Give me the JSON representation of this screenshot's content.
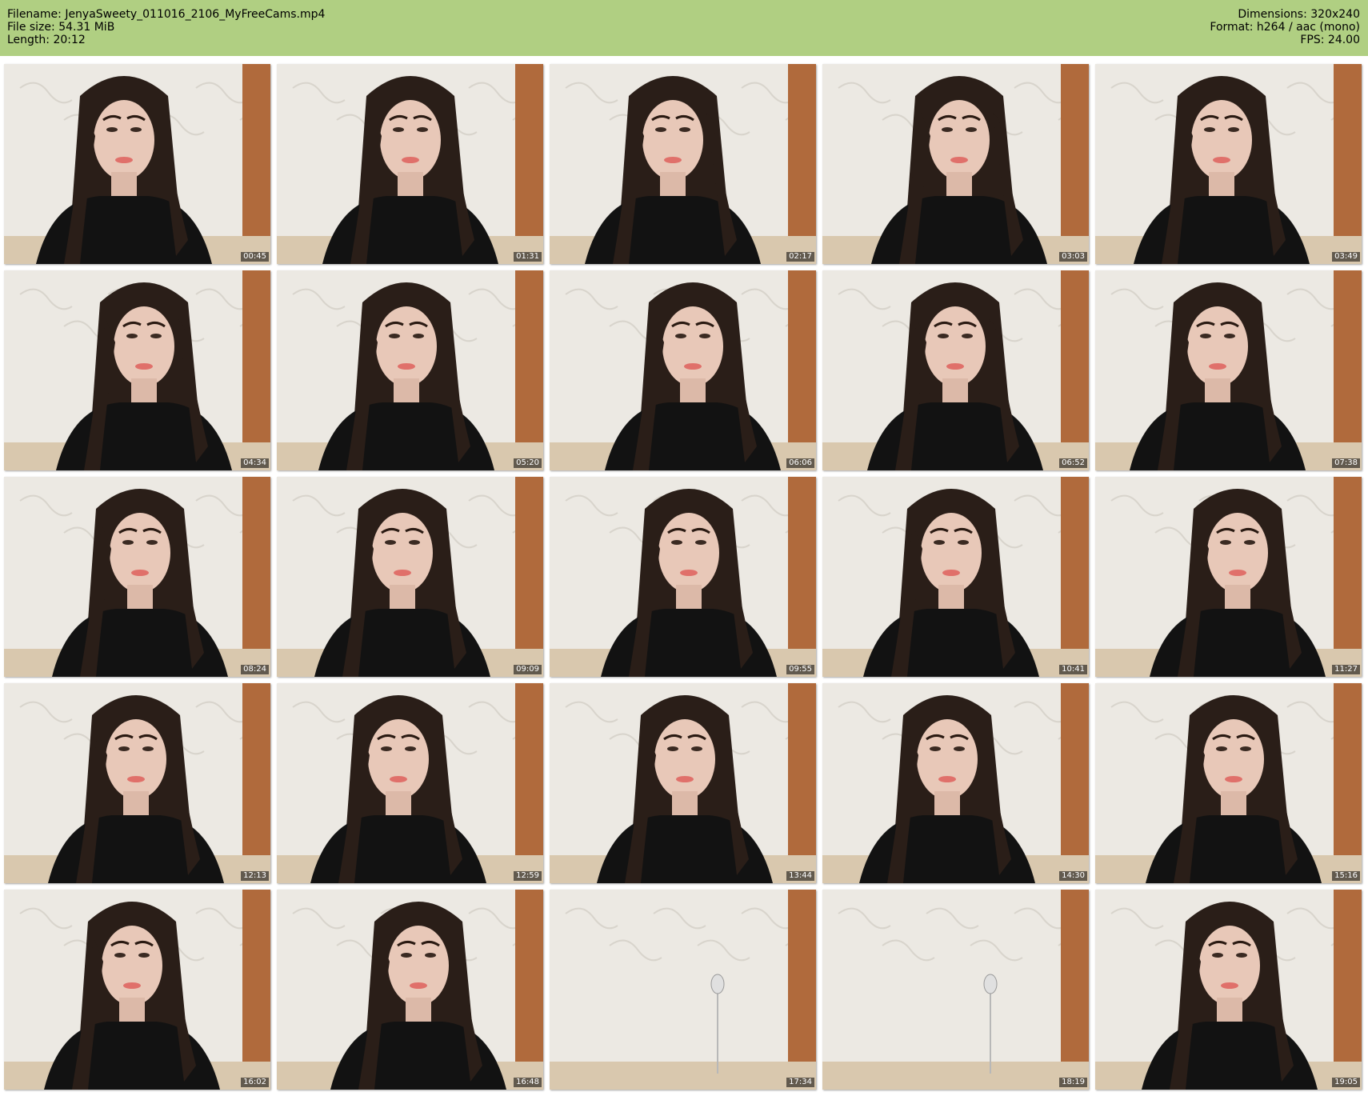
{
  "header": {
    "filename_label": "Filename:",
    "filename": "JenyaSweety_011016_2106_MyFreeCams.mp4",
    "filesize_label": "File size:",
    "filesize": "54.31 MiB",
    "length_label": "Length:",
    "length": "20:12",
    "dimensions_label": "Dimensions:",
    "dimensions": "320x240",
    "format_label": "Format:",
    "format": "h264 / aac (mono)",
    "fps_label": "FPS:",
    "fps": "24.00"
  },
  "colors": {
    "header_bg": "#b0cf82",
    "wall": "#ece9e3",
    "hair": "#2a1e18",
    "sweater": "#121212",
    "skin": "#e8c8b8",
    "wood": "#b06a3c"
  },
  "thumbnails": [
    {
      "time": "00:45",
      "empty": false
    },
    {
      "time": "01:31",
      "empty": false
    },
    {
      "time": "02:17",
      "empty": false
    },
    {
      "time": "03:03",
      "empty": false
    },
    {
      "time": "03:49",
      "empty": false
    },
    {
      "time": "04:34",
      "empty": false
    },
    {
      "time": "05:20",
      "empty": false
    },
    {
      "time": "06:06",
      "empty": false
    },
    {
      "time": "06:52",
      "empty": false
    },
    {
      "time": "07:38",
      "empty": false
    },
    {
      "time": "08:24",
      "empty": false
    },
    {
      "time": "09:09",
      "empty": false
    },
    {
      "time": "09:55",
      "empty": false
    },
    {
      "time": "10:41",
      "empty": false
    },
    {
      "time": "11:27",
      "empty": false
    },
    {
      "time": "12:13",
      "empty": false
    },
    {
      "time": "12:59",
      "empty": false
    },
    {
      "time": "13:44",
      "empty": false
    },
    {
      "time": "14:30",
      "empty": false
    },
    {
      "time": "15:16",
      "empty": false
    },
    {
      "time": "16:02",
      "empty": false
    },
    {
      "time": "16:48",
      "empty": false
    },
    {
      "time": "17:34",
      "empty": true
    },
    {
      "time": "18:19",
      "empty": true
    },
    {
      "time": "19:05",
      "empty": false
    }
  ]
}
